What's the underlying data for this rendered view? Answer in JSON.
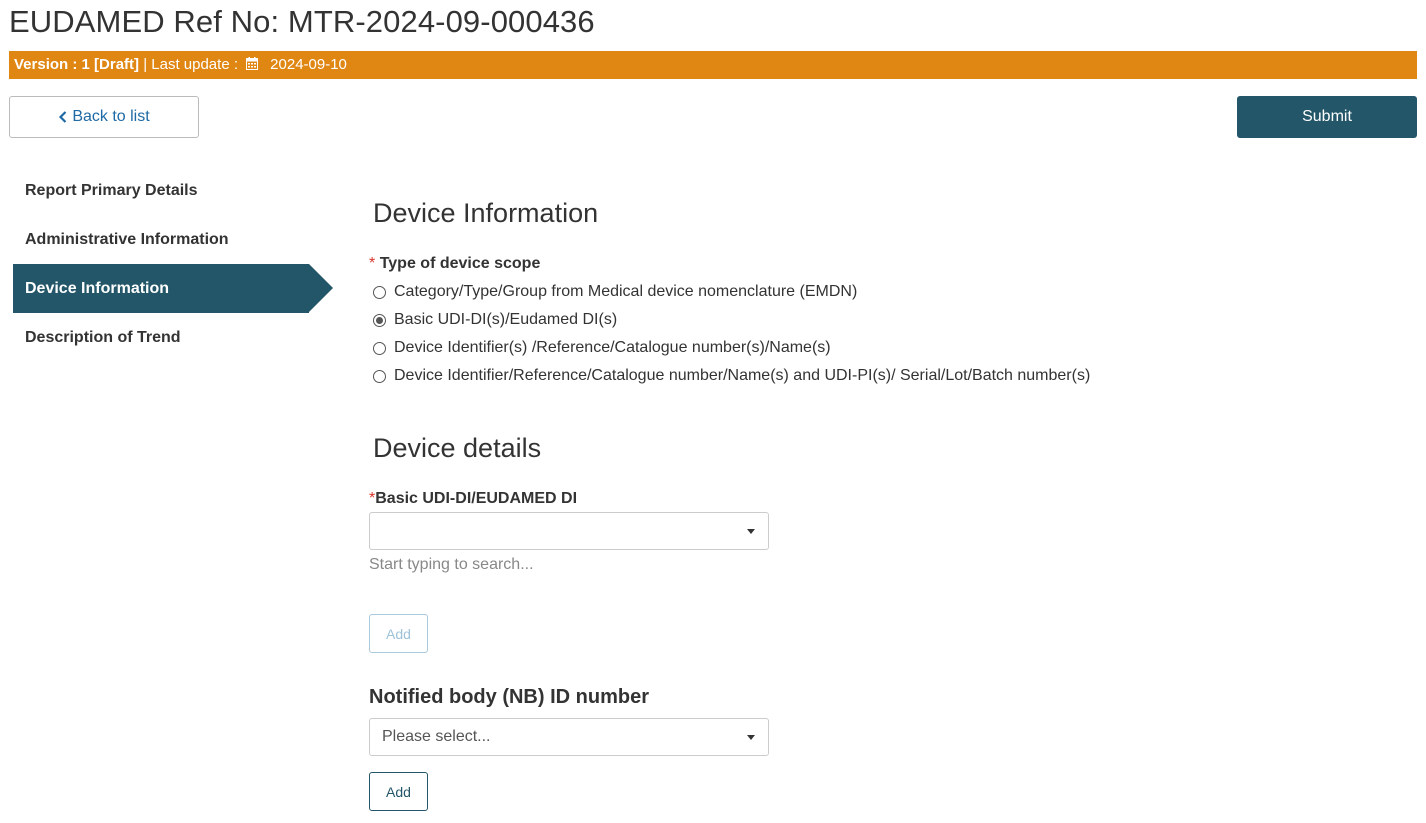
{
  "header": {
    "title": "EUDAMED Ref No: MTR-2024-09-000436",
    "version_label": "Version : 1 [Draft]",
    "last_update_label": " | Last update : ",
    "last_update_date": "2024-09-10"
  },
  "toolbar": {
    "back_label": "Back to list",
    "submit_label": "Submit"
  },
  "sidebar": {
    "items": [
      {
        "label": "Report Primary Details",
        "active": false
      },
      {
        "label": "Administrative Information",
        "active": false
      },
      {
        "label": "Device Information",
        "active": true
      },
      {
        "label": "Description of Trend",
        "active": false
      }
    ]
  },
  "device_information": {
    "title": "Device Information",
    "scope_label": "Type of device scope",
    "required_mark": "*",
    "options": [
      {
        "label": "Category/Type/Group from Medical device nomenclature (EMDN)",
        "checked": false
      },
      {
        "label": "Basic UDI-DI(s)/Eudamed DI(s)",
        "checked": true
      },
      {
        "label": "Device Identifier(s) /Reference/Catalogue number(s)/Name(s)",
        "checked": false
      },
      {
        "label": "Device Identifier/Reference/Catalogue number/Name(s) and UDI-PI(s)/ Serial/Lot/Batch number(s)",
        "checked": false
      }
    ]
  },
  "device_details": {
    "title": "Device details",
    "udi_label": "Basic UDI-DI/EUDAMED DI",
    "required_mark": "*",
    "udi_value": "",
    "udi_helper": "Start typing to search...",
    "add_label": "Add"
  },
  "notified_body": {
    "title": "Notified body (NB) ID number",
    "select_placeholder": "Please select...",
    "add_label": "Add"
  }
}
